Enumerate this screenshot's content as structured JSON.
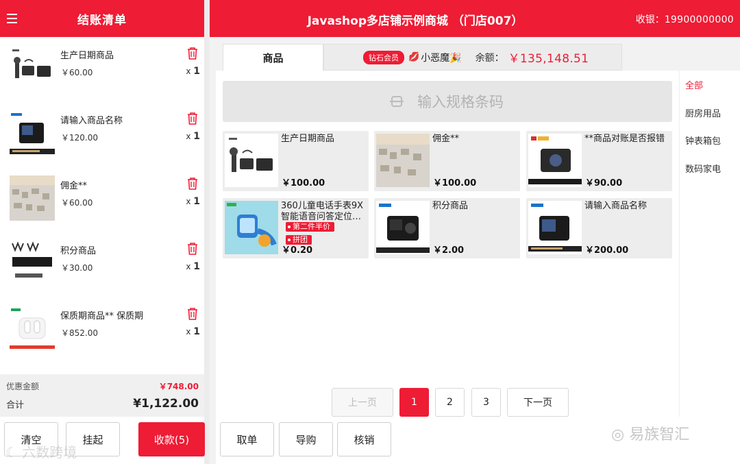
{
  "left": {
    "title": "结账清单",
    "items": [
      {
        "name": "生产日期商品",
        "price": "￥60.00",
        "qty_prefix": "x",
        "qty": "1"
      },
      {
        "name": "请输入商品名称",
        "price": "￥120.00",
        "qty_prefix": "x",
        "qty": "1"
      },
      {
        "name": "佣金**",
        "price": "￥60.00",
        "qty_prefix": "x",
        "qty": "1"
      },
      {
        "name": "积分商品",
        "price": "￥30.00",
        "qty_prefix": "x",
        "qty": "1"
      },
      {
        "name": "保质期商品** 保质期",
        "price": "￥852.00",
        "qty_prefix": "x",
        "qty": "1"
      }
    ],
    "discount_label": "优惠金额",
    "discount_value": "￥748.00",
    "total_label": "合计",
    "total_value": "¥1,122.00",
    "clear_label": "清空",
    "hang_label": "挂起",
    "checkout_label": "收款(5)"
  },
  "topbar": {
    "shop_title": "Javashop多店铺示例商城 （门店007）",
    "cashier_label": "收银：",
    "cashier_number": "19900000000"
  },
  "tabs": {
    "goods": "商品",
    "member_badge": "钻石会员",
    "member_name": "小恶魔",
    "balance_label": "余额：",
    "balance_value": "￥135,148.51"
  },
  "scan": {
    "placeholder": "输入规格条码"
  },
  "products": [
    {
      "name": "生产日期商品",
      "price": "￥100.00"
    },
    {
      "name": "佣金**",
      "price": "￥100.00"
    },
    {
      "name": "**商品对账是否报错",
      "price": "￥90.00"
    },
    {
      "name": "360儿童电话手表9X智能语音问答定位…",
      "price": "￥0.20",
      "promos": [
        "第二件半价",
        "拼团"
      ]
    },
    {
      "name": "积分商品",
      "price": "￥2.00"
    },
    {
      "name": "请输入商品名称",
      "price": "￥200.00"
    }
  ],
  "categories": [
    "全部",
    "厨房用品",
    "钟表箱包",
    "数码家电"
  ],
  "pager": {
    "prev": "上一页",
    "pages": [
      "1",
      "2",
      "3"
    ],
    "next": "下一页",
    "current": "1"
  },
  "actions": {
    "cancel": "取单",
    "guide": "导购",
    "verify": "核销"
  },
  "watermarks": {
    "left": "六数跨境",
    "right": "易族智汇"
  },
  "colors": {
    "accent": "#ee1c35"
  }
}
